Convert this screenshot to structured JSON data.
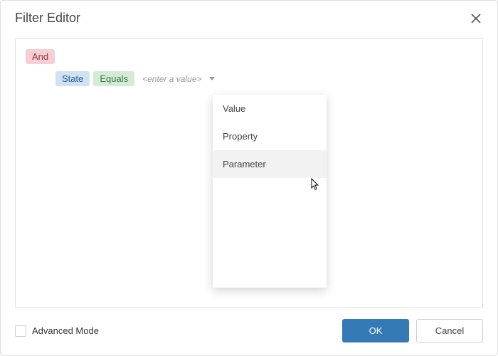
{
  "dialog": {
    "title": "Filter Editor"
  },
  "filter": {
    "group_operator": "And",
    "condition": {
      "field": "State",
      "operator": "Equals",
      "value_placeholder": "<enter a value>"
    }
  },
  "dropdown": {
    "items": [
      {
        "label": "Value"
      },
      {
        "label": "Property"
      },
      {
        "label": "Parameter"
      }
    ]
  },
  "footer": {
    "advanced_mode_label": "Advanced Mode",
    "ok_label": "OK",
    "cancel_label": "Cancel"
  }
}
